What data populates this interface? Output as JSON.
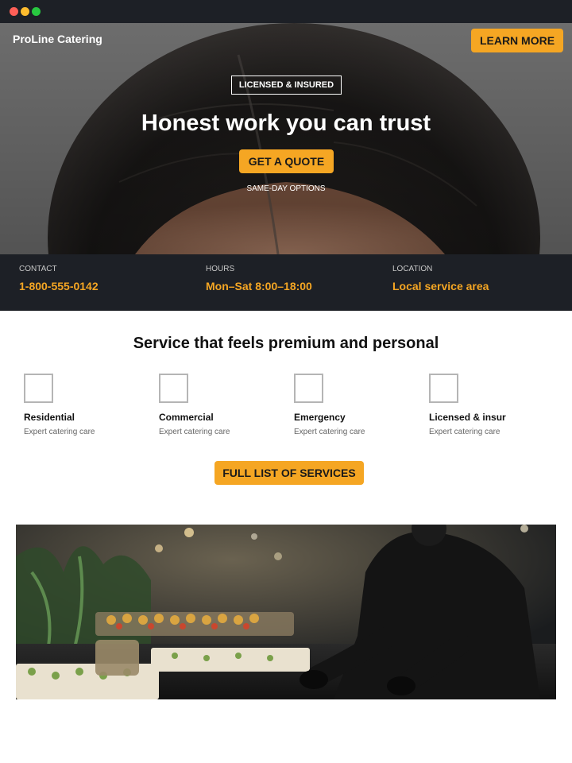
{
  "window": {
    "controls": [
      "close",
      "minimize",
      "maximize"
    ]
  },
  "header": {
    "brand": "ProLine Catering",
    "cta_label": "LEARN MORE"
  },
  "hero": {
    "badge": "LICENSED & INSURED",
    "title": "Honest work you can trust",
    "cta_label": "GET A QUOTE",
    "subtitle": "SAME-DAY OPTIONS"
  },
  "info": [
    {
      "label": "CONTACT",
      "value": "1-800-555-0142"
    },
    {
      "label": "HOURS",
      "value": "Mon–Sat 8:00–18:00"
    },
    {
      "label": "LOCATION",
      "value": "Local service area"
    }
  ],
  "services": {
    "title": "Service that feels premium and personal",
    "items": [
      {
        "title": "Residential",
        "desc": "Expert catering care"
      },
      {
        "title": "Commercial",
        "desc": "Expert catering care"
      },
      {
        "title": "Emergency",
        "desc": "Expert catering care"
      },
      {
        "title": "Licensed & insur",
        "desc": "Expert catering care"
      }
    ],
    "cta_label": "FULL LIST OF SERVICES"
  },
  "colors": {
    "accent": "#f5a623",
    "dark": "#1d2026"
  }
}
